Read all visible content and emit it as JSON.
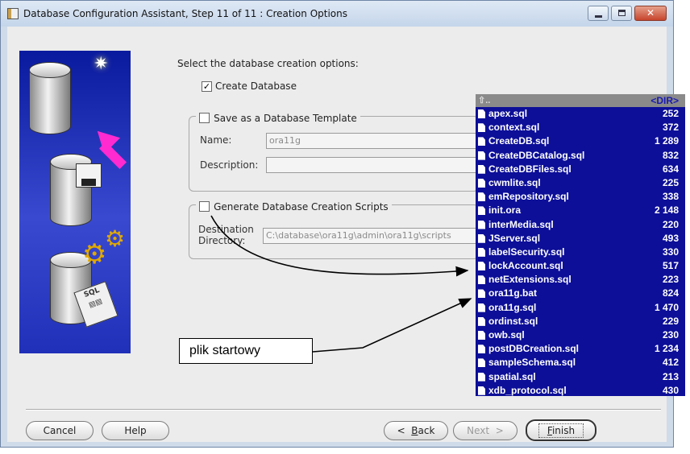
{
  "window": {
    "title": "Database Configuration Assistant, Step 11 of 11 : Creation Options"
  },
  "icons": [
    "app-icon",
    "minimize-icon",
    "maximize-icon",
    "close-icon",
    "database-icon",
    "floppy-icon",
    "gear-icon",
    "sql-scroll-icon",
    "file-icon",
    "up-folder-icon"
  ],
  "options": {
    "instruction": "Select the database creation options:",
    "create_database": {
      "label": "Create Database",
      "checked": true,
      "mark": "✓"
    },
    "save_template": {
      "label": "Save as a Database Template",
      "name_label": "Name:",
      "name_value": "ora11g",
      "description_label": "Description:",
      "description_value": ""
    },
    "generate_scripts": {
      "label": "Generate Database Creation Scripts",
      "destination_label_1": "Destination",
      "destination_label_2": "Directory:",
      "destination_value": "C:\\database\\ora11g\\admin\\ora11g\\scripts"
    }
  },
  "buttons": {
    "cancel": "Cancel",
    "help": "Help",
    "back_arrow": "<",
    "back_hotkey": "B",
    "back_rest": "ack",
    "next": "Next",
    "next_arrow": ">",
    "finish_hotkey": "F",
    "finish_rest": "inish"
  },
  "filelist": {
    "header_up": "⇧..",
    "header_dir": "<DIR>",
    "files": [
      {
        "name": "apex.sql",
        "size": "252"
      },
      {
        "name": "context.sql",
        "size": "372"
      },
      {
        "name": "CreateDB.sql",
        "size": "1 289"
      },
      {
        "name": "CreateDBCatalog.sql",
        "size": "832"
      },
      {
        "name": "CreateDBFiles.sql",
        "size": "634"
      },
      {
        "name": "cwmlite.sql",
        "size": "225"
      },
      {
        "name": "emRepository.sql",
        "size": "338"
      },
      {
        "name": "init.ora",
        "size": "2 148"
      },
      {
        "name": "interMedia.sql",
        "size": "220"
      },
      {
        "name": "JServer.sql",
        "size": "493"
      },
      {
        "name": "labelSecurity.sql",
        "size": "330"
      },
      {
        "name": "lockAccount.sql",
        "size": "517"
      },
      {
        "name": "netExtensions.sql",
        "size": "223"
      },
      {
        "name": "ora11g.bat",
        "size": "824"
      },
      {
        "name": "ora11g.sql",
        "size": "1 470"
      },
      {
        "name": "ordinst.sql",
        "size": "229"
      },
      {
        "name": "owb.sql",
        "size": "230"
      },
      {
        "name": "postDBCreation.sql",
        "size": "1 234"
      },
      {
        "name": "sampleSchema.sql",
        "size": "412"
      },
      {
        "name": "spatial.sql",
        "size": "213"
      },
      {
        "name": "xdb_protocol.sql",
        "size": "430"
      }
    ]
  },
  "annotation": {
    "callout": "plik startowy"
  },
  "colors": {
    "filelist_bg": "#0d0f98",
    "art_bg": "#0a1a9e",
    "pink_arrow": "#ff2bd0"
  }
}
